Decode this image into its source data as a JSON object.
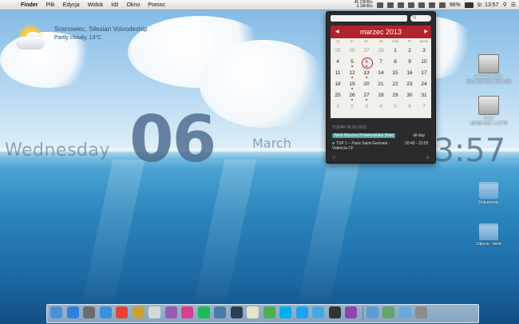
{
  "menubar": {
    "apple": "",
    "items": [
      "Finder",
      "Plik",
      "Edycja",
      "Widok",
      "Idź",
      "Okno",
      "Pomoc"
    ],
    "battery": "96%",
    "clock": "śr. 13:57",
    "tray_small_1": "45.23KB/s",
    "tray_small_2": "3.18KB/s"
  },
  "weather": {
    "location": "Sosnowiec, Silesian Voivodeship",
    "description": "Partly cloudy, 13°C"
  },
  "clock_widget": {
    "weekday": "Wednesday",
    "date": "06",
    "month": "March",
    "time": "13:57"
  },
  "calendar": {
    "month_title": "marzec 2013",
    "weekdays": [
      "CZ",
      "PT",
      "WT",
      "ŚR",
      "SOB",
      "PT",
      "NIEDZ"
    ],
    "weeks": [
      [
        "25",
        "26",
        "27",
        "28",
        "1",
        "2",
        "3"
      ],
      [
        "4",
        "5",
        "6",
        "7",
        "8",
        "9",
        "10"
      ],
      [
        "11",
        "12",
        "13",
        "14",
        "15",
        "16",
        "17"
      ],
      [
        "18",
        "19",
        "20",
        "21",
        "22",
        "23",
        "24"
      ],
      [
        "25",
        "26",
        "27",
        "28",
        "29",
        "30",
        "31"
      ],
      [
        "1",
        "2",
        "3",
        "4",
        "5",
        "6",
        "7"
      ]
    ],
    "today_label": "TODAY 06.03.2013",
    "events": [
      {
        "title": "Tekst Marcina Potwierańska (fote)",
        "time": "all-day"
      },
      {
        "title": "TVP 1 – Paris Saint-Germain - Valencia CF",
        "time": "20:40 - 22:55"
      }
    ]
  },
  "desktop_icons": [
    {
      "label": "Macintosh SSD",
      "sublabel": "256,2 GB dost. 234,9 GB",
      "kind": "hdd"
    },
    {
      "label": "Dane",
      "sublabel": "4,8 GB dost. 1,19 TB",
      "kind": "hdd"
    },
    {
      "label": "Dokumenty",
      "sublabel": "",
      "kind": "folder"
    },
    {
      "label": "Zdjęcia - skrót",
      "sublabel": "",
      "kind": "folder"
    }
  ],
  "dock": {
    "items": [
      {
        "name": "finder",
        "color": "#4a8fd8"
      },
      {
        "name": "app-store",
        "color": "#2f7fe0"
      },
      {
        "name": "system-prefs",
        "color": "#6d6d6d"
      },
      {
        "name": "safari",
        "color": "#3a90d9"
      },
      {
        "name": "chrome",
        "color": "#e94235"
      },
      {
        "name": "mail",
        "color": "#caa030"
      },
      {
        "name": "calendar",
        "color": "#d8d8d8"
      },
      {
        "name": "photos",
        "color": "#9b59b6"
      },
      {
        "name": "itunes",
        "color": "#e03c8f"
      },
      {
        "name": "spotify",
        "color": "#1db954"
      },
      {
        "name": "iphoto",
        "color": "#4b79a8"
      },
      {
        "name": "movie",
        "color": "#2c3e50"
      },
      {
        "name": "notes",
        "color": "#e8e2c6"
      },
      {
        "name": "evernote",
        "color": "#4caf50"
      },
      {
        "name": "skype",
        "color": "#00aff0"
      },
      {
        "name": "twitter",
        "color": "#1da1f2"
      },
      {
        "name": "messages",
        "color": "#49a8e3"
      },
      {
        "name": "terminal",
        "color": "#333333"
      },
      {
        "name": "iina",
        "color": "#8e44ad"
      },
      {
        "name": "downloads",
        "color": "#5c9ad7"
      },
      {
        "name": "stack",
        "color": "#67a36a"
      },
      {
        "name": "documents",
        "color": "#6aa8d9"
      },
      {
        "name": "trash",
        "color": "#8c8c8c"
      }
    ]
  }
}
